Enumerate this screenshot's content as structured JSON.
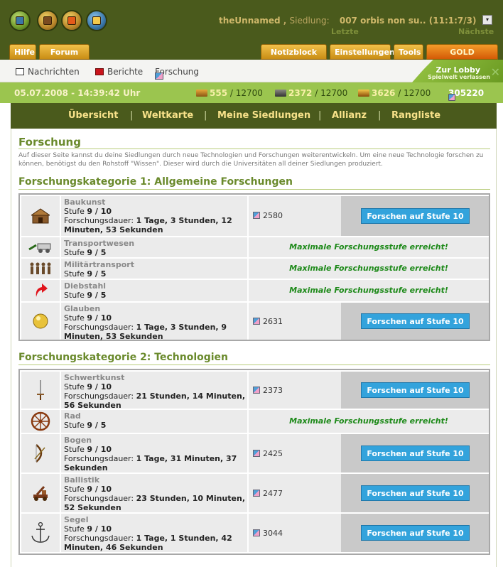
{
  "header": {
    "username": "theUnnamed",
    "separator": ",",
    "settlement_label": "Siedlung:",
    "settlement_value": "007 orbis non su.. (11:1:7/3)",
    "prev": "Letzte",
    "next": "Nächste",
    "dropdown": "▾",
    "icons": [
      "world-icon",
      "settlement-icon",
      "messages-icon",
      "gold-chest-icon"
    ]
  },
  "menu": {
    "hilfe": "Hilfe",
    "forum": "Forum [»]",
    "notizblock": "Notizblock [»]",
    "einstellungen": "Einstellungen",
    "tools": "Tools",
    "gold": "GOLD ACCOUNT"
  },
  "submenu": {
    "nachrichten": "Nachrichten",
    "berichte": "Berichte",
    "forschung": "Forschung",
    "lobby": "Zur Lobby",
    "lobby_sub": "Spielwelt verlassen",
    "close": "✕"
  },
  "resources": {
    "datetime": "05.07.2008 - 14:39:42 Uhr",
    "wood": "555",
    "wood_max": "/ 12700",
    "stone": "2372",
    "stone_max": "/ 12700",
    "ore": "3626",
    "ore_max": "/ 12700",
    "knowledge": "305220"
  },
  "nav": {
    "uebersicht": "Übersicht",
    "weltkarte": "Weltkarte",
    "siedlungen": "Meine Siedlungen",
    "allianz": "Allianz",
    "rangliste": "Rangliste",
    "sep": "|"
  },
  "page": {
    "title": "Forschung",
    "description": "Auf dieser Seite kannst du deine Siedlungen durch neue Technologien und Forschungen weiterentwickeln. Um eine neue Technologie forschen zu können, benötigst du den Rohstoff \"Wissen\". Dieser wird durch die Universitäten all deiner Siedlungen produziert."
  },
  "labels": {
    "stufe": "Stufe",
    "dauer": "Forschungsdauer:",
    "max": "Maximale Forschungsstufe erreicht!"
  },
  "cat1": {
    "title": "Forschungskategorie 1: Allgemeine Forschungen",
    "rows": [
      {
        "name": "Baukunst",
        "level": "9 / 10",
        "duration": "1 Tage, 3 Stunden, 12 Minuten, 53 Sekunden",
        "cost": "2580",
        "button": "Forschen auf Stufe 10",
        "icon": "building-icon"
      },
      {
        "name": "Transportwesen",
        "level": "9 / 5",
        "icon": "cart-icon"
      },
      {
        "name": "Militärtransport",
        "level": "9 / 5",
        "icon": "soldiers-icon"
      },
      {
        "name": "Diebstahl",
        "level": "9 / 5",
        "icon": "red-arrow-icon"
      },
      {
        "name": "Glauben",
        "level": "9 / 10",
        "duration": "1 Tage, 3 Stunden, 9 Minuten, 53 Sekunden",
        "cost": "2631",
        "button": "Forschen auf Stufe 10",
        "icon": "golden-orb-icon"
      }
    ]
  },
  "cat2": {
    "title": "Forschungskategorie 2: Technologien",
    "rows": [
      {
        "name": "Schwertkunst",
        "level": "9 / 10",
        "duration": "21 Stunden, 14 Minuten, 56 Sekunden",
        "cost": "2373",
        "button": "Forschen auf Stufe 10",
        "icon": "sword-icon"
      },
      {
        "name": "Rad",
        "level": "9 / 5",
        "icon": "wheel-icon"
      },
      {
        "name": "Bogen",
        "level": "9 / 10",
        "duration": "1 Tage, 31 Minuten, 37 Sekunden",
        "cost": "2425",
        "button": "Forschen auf Stufe 10",
        "icon": "bow-icon"
      },
      {
        "name": "Ballistik",
        "level": "9 / 10",
        "duration": "23 Stunden, 10 Minuten, 52 Sekunden",
        "cost": "2477",
        "button": "Forschen auf Stufe 10",
        "icon": "catapult-icon"
      },
      {
        "name": "Segel",
        "level": "9 / 10",
        "duration": "1 Tage, 1 Stunden, 42 Minuten, 46 Sekunden",
        "cost": "3044",
        "button": "Forschen auf Stufe 10",
        "icon": "anchor-icon"
      }
    ]
  },
  "colors": {
    "accent": "#6a8a2c",
    "header_bg": "#4a5a1c",
    "button": "#33a3dc",
    "success": "#1e8a1a"
  }
}
